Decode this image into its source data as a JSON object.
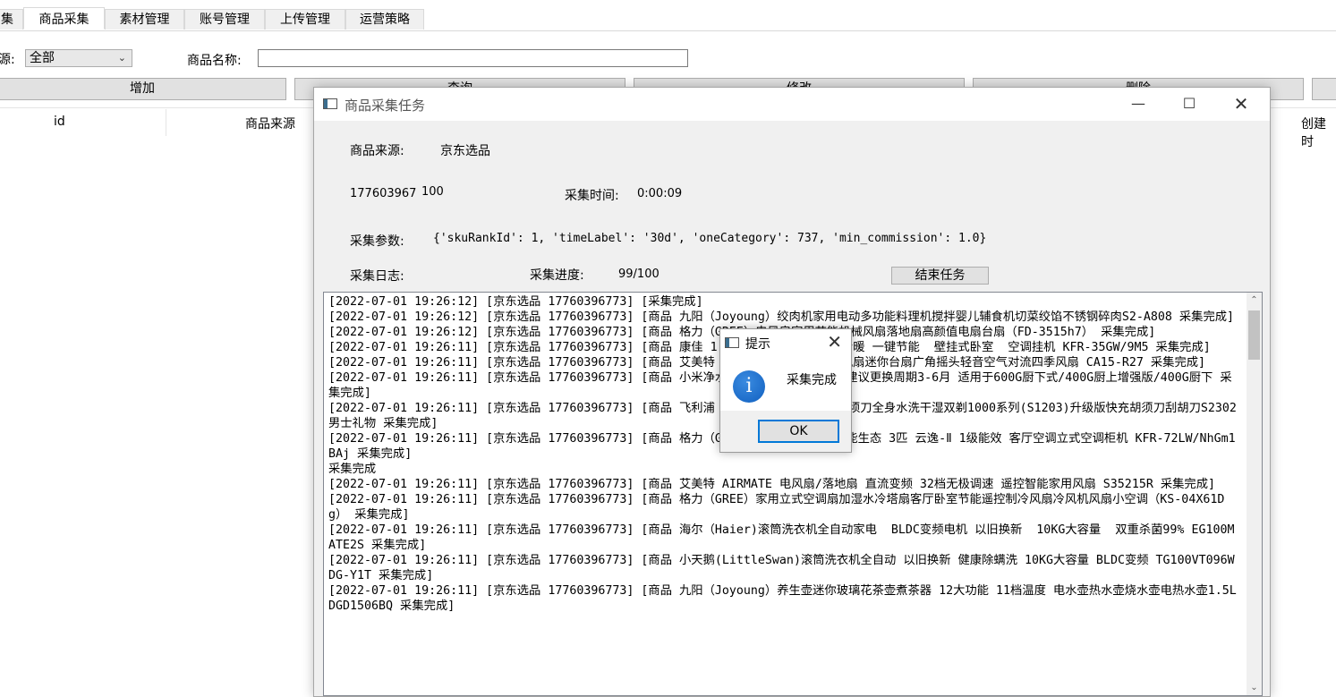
{
  "tabs": [
    "集",
    "商品采集",
    "素材管理",
    "账号管理",
    "上传管理",
    "运营策略"
  ],
  "active_tab_index": 1,
  "filter": {
    "source_label": "源:",
    "source_value": "全部",
    "name_label": "商品名称:",
    "name_value": ""
  },
  "buttons": {
    "add": "增加",
    "query": "查询",
    "edit": "修改",
    "delete": "删除"
  },
  "columns": {
    "id": "id",
    "source": "商品来源",
    "created": "创建时"
  },
  "dialog": {
    "title": "商品采集任务",
    "source_label": "商品来源:",
    "source_value": "京东选品",
    "account_id": "177603967",
    "count": "100",
    "time_label": "采集时间:",
    "time_value": "0:00:09",
    "params_label": "采集参数:",
    "params_value": "{'skuRankId': 1, 'timeLabel': '30d', 'oneCategory': 737, 'min_commission': 1.0}",
    "log_label": "采集日志:",
    "progress_label": "采集进度:",
    "progress_value": "99/100",
    "end_button": "结束任务",
    "log_text": "[2022-07-01 19:26:12] [京东选品 17760396773] [采集完成]\n[2022-07-01 19:26:12] [京东选品 17760396773] [商品 九阳（Joyoung）绞肉机家用电动多功能料理机搅拌婴儿辅食机切菜绞馅不锈钢碎肉S2-A808 采集完成]\n[2022-07-01 19:26:12] [京东选品 17760396773] [商品 格力（GREE）电风扇家用节能机械风扇落地扇高颜值电扇台扇（FD-3515h7） 采集完成]\n[2022-07-01 19:26:11] [京东选品 17760396773] [商品 康佳 1.5匹 新一级能效 快速冷暖 一键节能  壁挂式卧室  空调挂机 KFR-35GW/9M5 采集完成]\n[2022-07-01 19:26:11] [京东选品 17760396773] [商品 艾美特 电风扇宿舍学生节能小风扇迷你台扇广角摇头轻音空气对流四季风扇 CA15-R27 采集完成]\n[2022-07-01 19:26:11] [京东选品 17760396773] [商品 小米净水器 PP棉 自来水过滤 建议更换周期3-6月 适用于600G厨下式/400G厨上增强版/400G厨下 采集完成]\n[2022-07-01 19:26:11] [京东选品 17760396773] [商品 飞利浦（PHILIPS）男士电动剃须刀全身水洗干湿双剃1000系列(S1203)升级版快充胡须刀刮胡刀S2302 男士礼物 采集完成]\n[2022-07-01 19:26:11] [京东选品 17760396773] [商品 格力（GREE）空调 京东小家智能生态 3匹 云逸-Ⅱ 1级能效 客厅空调立式空调柜机 KFR-72LW/NhGm1BAj 采集完成]\n采集完成\n[2022-07-01 19:26:11] [京东选品 17760396773] [商品 艾美特 AIRMATE 电风扇/落地扇 直流变频 32档无极调速 遥控智能家用风扇 S35215R 采集完成]\n[2022-07-01 19:26:11] [京东选品 17760396773] [商品 格力（GREE）家用立式空调扇加湿水冷塔扇客厅卧室节能遥控制冷风扇冷风机风扇小空调（KS-04X61Dg） 采集完成]\n[2022-07-01 19:26:11] [京东选品 17760396773] [商品 海尔（Haier)滚筒洗衣机全自动家电  BLDC变频电机 以旧换新  10KG大容量  双重杀菌99% EG100MATE2S 采集完成]\n[2022-07-01 19:26:11] [京东选品 17760396773] [商品 小天鹅(LittleSwan)滚筒洗衣机全自动 以旧换新 健康除螨洗 10KG大容量 BLDC变频 TG100VT096WDG-Y1T 采集完成]\n[2022-07-01 19:26:11] [京东选品 17760396773] [商品 九阳（Joyoung）养生壶迷你玻璃花茶壶煮茶器 12大功能 11档温度 电水壶热水壶烧水壶电热水壶1.5L DGD1506BQ 采集完成]"
  },
  "message_box": {
    "title": "提示",
    "text": "采集完成",
    "ok": "OK",
    "icon": "info-icon"
  }
}
